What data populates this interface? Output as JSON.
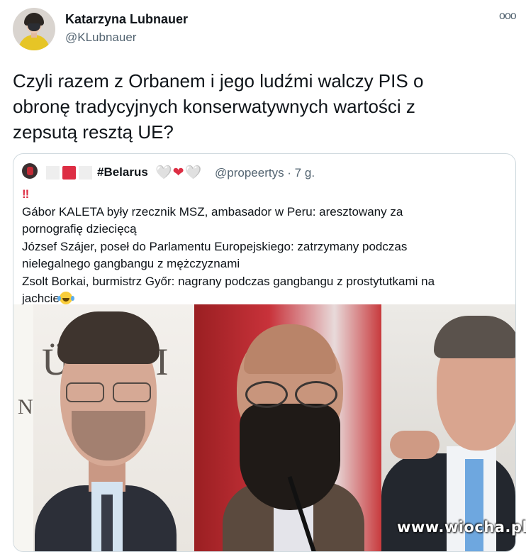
{
  "author": {
    "name": "Katarzyna Lubnauer",
    "handle": "@KLubnauer"
  },
  "more_icon": "ooo",
  "tweet_text": "Czyli razem z Orbanem i jego ludźmi walczy PIS o\nobronę tradycyjnych konserwatywnych wartości z\nzepsutą resztą UE?",
  "quoted": {
    "name": "#Belarus",
    "hearts": [
      "🤍",
      "❤",
      "🤍"
    ],
    "handle_time": "@propeertys · 7 g.",
    "lines": [
      "Gábor KALETA były rzecznik MSZ, ambasador w Peru: aresztowany za",
      "pornografię dziecięcą",
      "József Szájer, poseł do Parlamentu Europejskiego: zatrzymany podczas",
      "nielegalnego gangbangu z mężczyznami",
      "Zsolt Borkai, burmistrz Győr: nagrany podczas gangbangu z prostytutkami na",
      "jachcie"
    ],
    "exclamation": "‼",
    "photo_bg_text_1": "ÜR  MI",
    "photo_bg_text_2": "N  I  R"
  },
  "watermark": "www.wiocha.pl",
  "colors": {
    "text": "#0f1419",
    "secondary": "#536471",
    "border": "#cfd9de",
    "red": "#dd2e44"
  }
}
